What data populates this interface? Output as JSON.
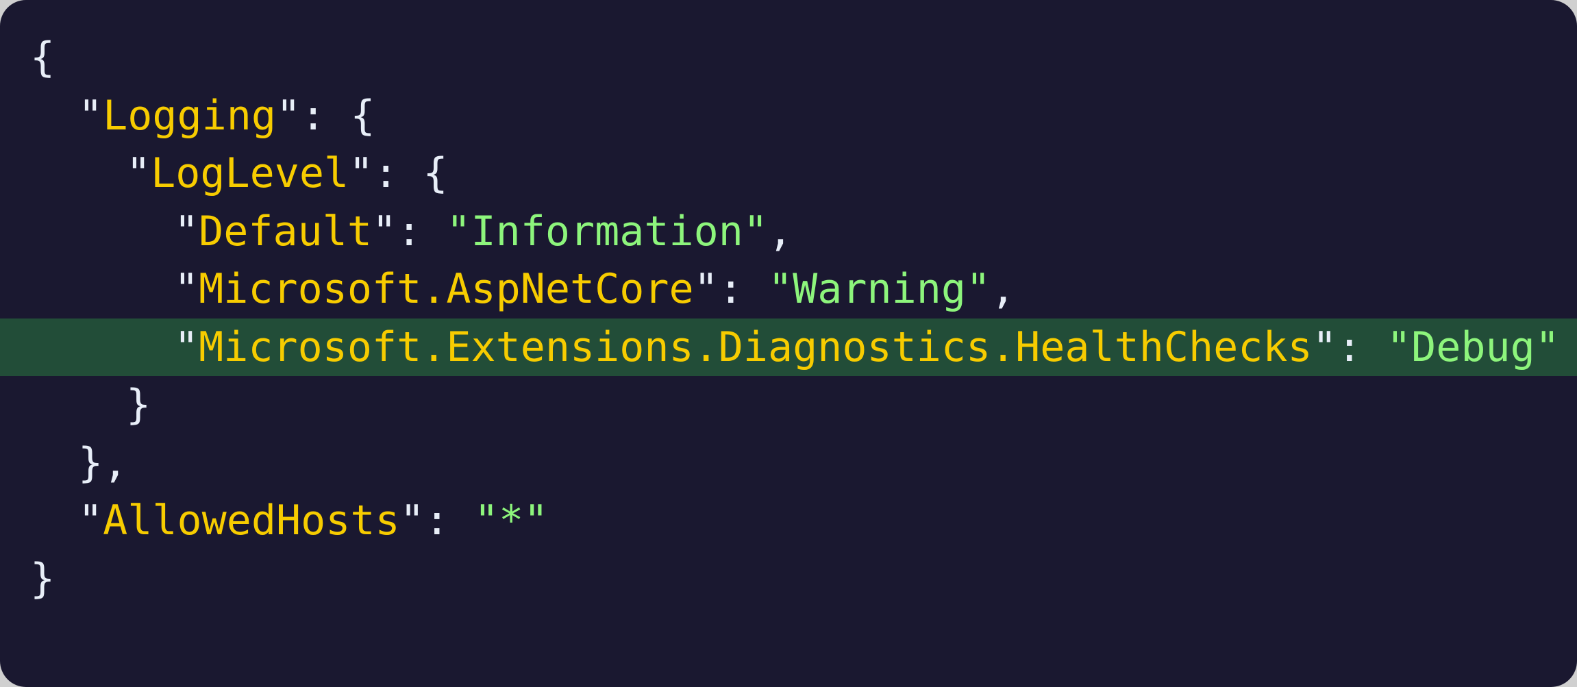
{
  "code": {
    "lines": [
      {
        "indent": 0,
        "parts": [
          {
            "t": "p",
            "v": "{"
          }
        ]
      },
      {
        "indent": 1,
        "parts": [
          {
            "t": "p",
            "v": "\""
          },
          {
            "t": "k",
            "v": "Logging"
          },
          {
            "t": "p",
            "v": "\": {"
          }
        ]
      },
      {
        "indent": 2,
        "parts": [
          {
            "t": "p",
            "v": "\""
          },
          {
            "t": "k",
            "v": "LogLevel"
          },
          {
            "t": "p",
            "v": "\": {"
          }
        ]
      },
      {
        "indent": 3,
        "parts": [
          {
            "t": "p",
            "v": "\""
          },
          {
            "t": "k",
            "v": "Default"
          },
          {
            "t": "p",
            "v": "\": "
          },
          {
            "t": "s",
            "v": "\"Information\""
          },
          {
            "t": "p",
            "v": ","
          }
        ]
      },
      {
        "indent": 3,
        "parts": [
          {
            "t": "p",
            "v": "\""
          },
          {
            "t": "k",
            "v": "Microsoft.AspNetCore"
          },
          {
            "t": "p",
            "v": "\": "
          },
          {
            "t": "s",
            "v": "\"Warning\""
          },
          {
            "t": "p",
            "v": ","
          }
        ]
      },
      {
        "indent": 3,
        "highlighted": true,
        "parts": [
          {
            "t": "p",
            "v": "\""
          },
          {
            "t": "k",
            "v": "Microsoft.Extensions.Diagnostics.HealthChecks"
          },
          {
            "t": "p",
            "v": "\": "
          },
          {
            "t": "s",
            "v": "\"Debug\""
          }
        ]
      },
      {
        "indent": 2,
        "parts": [
          {
            "t": "p",
            "v": "}"
          }
        ]
      },
      {
        "indent": 1,
        "parts": [
          {
            "t": "p",
            "v": "},"
          }
        ]
      },
      {
        "indent": 1,
        "parts": [
          {
            "t": "p",
            "v": "\""
          },
          {
            "t": "k",
            "v": "AllowedHosts"
          },
          {
            "t": "p",
            "v": "\": "
          },
          {
            "t": "s",
            "v": "\"*\""
          }
        ]
      },
      {
        "indent": 0,
        "parts": [
          {
            "t": "p",
            "v": "}"
          }
        ]
      }
    ]
  },
  "colors": {
    "background": "#1a1830",
    "highlight": "#224d38",
    "key": "#f7cc00",
    "string": "#8df57c",
    "punctuation": "#e8eef8"
  }
}
